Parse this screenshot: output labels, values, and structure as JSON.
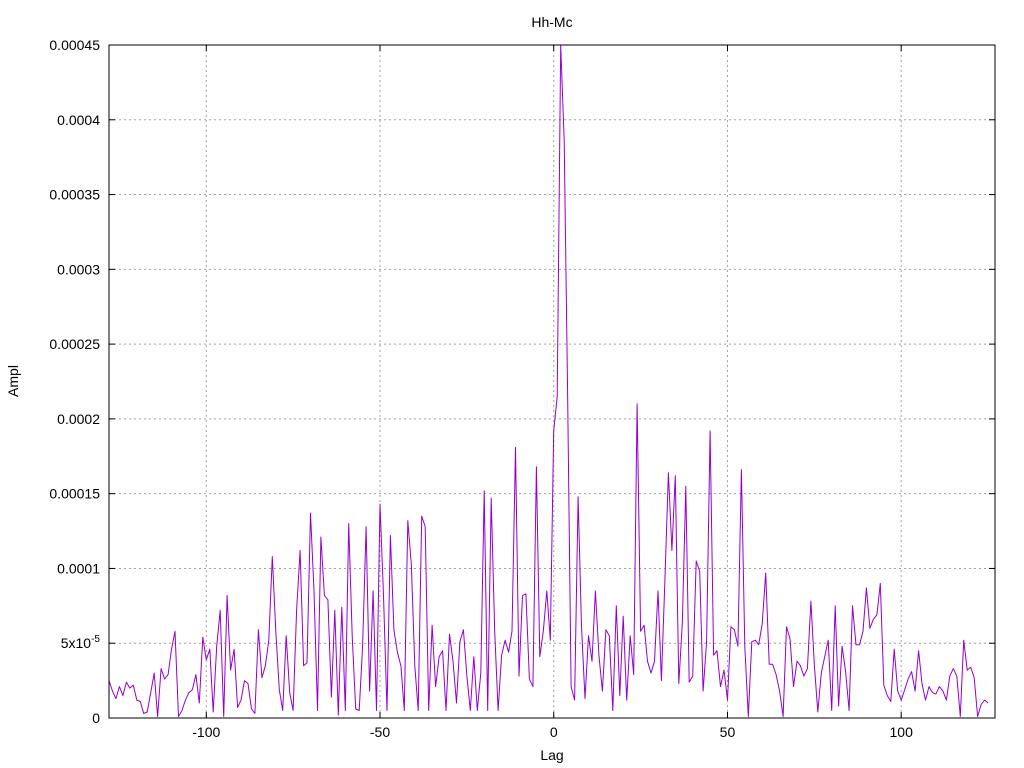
{
  "chart_data": {
    "type": "line",
    "title": "Hh-Mc",
    "xlabel": "Lag",
    "ylabel": "Ampl",
    "xlim": [
      -128,
      127
    ],
    "ylim": [
      0,
      0.00045
    ],
    "x_ticks": [
      {
        "value": -100,
        "label": "-100"
      },
      {
        "value": -50,
        "label": "-50"
      },
      {
        "value": 0,
        "label": "0"
      },
      {
        "value": 50,
        "label": "50"
      },
      {
        "value": 100,
        "label": "100"
      }
    ],
    "y_ticks": [
      {
        "value": 0,
        "label": "0"
      },
      {
        "value": 5e-05,
        "label": "5x10",
        "sup": "-5"
      },
      {
        "value": 0.0001,
        "label": "0.0001"
      },
      {
        "value": 0.00015,
        "label": "0.00015"
      },
      {
        "value": 0.0002,
        "label": "0.0002"
      },
      {
        "value": 0.00025,
        "label": "0.00025"
      },
      {
        "value": 0.0003,
        "label": "0.0003"
      },
      {
        "value": 0.00035,
        "label": "0.00035"
      },
      {
        "value": 0.0004,
        "label": "0.0004"
      },
      {
        "value": 0.00045,
        "label": "0.00045"
      }
    ],
    "grid": true,
    "series": [
      {
        "color": "#9400d3",
        "x_start": -128,
        "x_step": 1,
        "values": [
          2.5e-05,
          1.8e-05,
          1.3e-05,
          2.1e-05,
          1.5e-05,
          2.4e-05,
          2e-05,
          2.2e-05,
          1.2e-05,
          1.1e-05,
          3e-06,
          4e-06,
          1.7e-05,
          3e-05,
          1e-06,
          3.3e-05,
          2.6e-05,
          2.9e-05,
          4.6e-05,
          5.8e-05,
          1e-06,
          5e-06,
          1.2e-05,
          1.7e-05,
          1.9e-05,
          2.9e-05,
          1e-05,
          5.4e-05,
          3.9e-05,
          4.6e-05,
          4e-06,
          4.8e-05,
          7.2e-05,
          1e-06,
          8.2e-05,
          3.2e-05,
          4.6e-05,
          7e-06,
          1.2e-05,
          2.5e-05,
          2.3e-05,
          6e-06,
          3e-06,
          5.9e-05,
          2.7e-05,
          3.5e-05,
          5.2e-05,
          0.000108,
          5.8e-05,
          1.9e-05,
          5e-06,
          5.5e-05,
          1.7e-05,
          5e-06,
          7.2e-05,
          0.000112,
          3.5e-05,
          3.7e-05,
          0.000137,
          8.5e-05,
          5e-06,
          0.000121,
          8.2e-05,
          7.9e-05,
          1.4e-05,
          7.2e-05,
          2e-06,
          7.4e-05,
          5e-06,
          0.00013,
          5.5e-05,
          6e-06,
          5e-06,
          4.8e-05,
          0.000128,
          1.8e-05,
          8.5e-05,
          5e-06,
          0.000143,
          8.2e-05,
          5e-06,
          0.000122,
          5.9e-05,
          4.4e-05,
          3.5e-05,
          5e-06,
          0.000132,
          0.000103,
          3.5e-05,
          5e-06,
          0.000135,
          0.000128,
          5e-06,
          6.2e-05,
          2.1e-05,
          4.1e-05,
          4.5e-05,
          5e-06,
          5.6e-05,
          3.8e-05,
          1e-05,
          5.1e-05,
          5.9e-05,
          2.8e-05,
          5e-06,
          4.1e-05,
          5e-06,
          3e-05,
          0.000152,
          5e-06,
          0.000147,
          5.8e-05,
          5e-06,
          4.2e-05,
          5.2e-05,
          4.4e-05,
          5.8e-05,
          0.000181,
          2.8e-05,
          8.2e-05,
          8.3e-05,
          2.6e-05,
          2.1e-05,
          0.000168,
          4.1e-05,
          5.8e-05,
          8.5e-05,
          5.2e-05,
          0.000192,
          0.000215,
          0.00045,
          0.000386,
          0.000218,
          2.1e-05,
          1.2e-05,
          0.000148,
          6.1e-05,
          1.3e-05,
          5.5e-05,
          3.8e-05,
          8.5e-05,
          4.2e-05,
          1.8e-05,
          5.9e-05,
          5.5e-05,
          5e-06,
          7.5e-05,
          1.5e-05,
          6.8e-05,
          1.2e-05,
          5.5e-05,
          2.9e-05,
          0.00021,
          5.8e-05,
          6.2e-05,
          3.8e-05,
          3e-05,
          3.8e-05,
          8.5e-05,
          2.5e-05,
          9.2e-05,
          0.000164,
          0.000112,
          0.000162,
          2.3e-05,
          6.3e-05,
          0.000155,
          2.4e-05,
          2.8e-05,
          0.000105,
          9.8e-05,
          1.8e-05,
          5.1e-05,
          0.000192,
          4.2e-05,
          4.5e-05,
          2.1e-05,
          3.2e-05,
          1.2e-05,
          6.1e-05,
          5.9e-05,
          4.8e-05,
          0.000166,
          4.8e-05,
          1e-06,
          5.1e-05,
          5.2e-05,
          4.9e-05,
          6.3e-05,
          9.7e-05,
          3.6e-05,
          3.6e-05,
          2.9e-05,
          1.8e-05,
          1e-06,
          6.1e-05,
          5.3e-05,
          2.1e-05,
          3.8e-05,
          3.5e-05,
          2.8e-05,
          3.3e-05,
          7.8e-05,
          3.6e-05,
          4e-06,
          3e-05,
          4.1e-05,
          5.2e-05,
          5e-06,
          7.5e-05,
          8e-06,
          4.8e-05,
          3.1e-05,
          5e-06,
          7.5e-05,
          4.9e-05,
          4.9e-05,
          5.8e-05,
          8.7e-05,
          6e-05,
          6.6e-05,
          6.9e-05,
          9e-05,
          2.2e-05,
          1.5e-05,
          1.1e-05,
          4.6e-05,
          1.8e-05,
          1.2e-05,
          1.9e-05,
          2.6e-05,
          3.1e-05,
          1.8e-05,
          4.5e-05,
          2.3e-05,
          1.2e-05,
          2.1e-05,
          1.7e-05,
          1.6e-05,
          2.1e-05,
          1.8e-05,
          1.2e-05,
          2.8e-05,
          3.3e-05,
          2.8e-05,
          1e-06,
          5.2e-05,
          3.2e-05,
          3.4e-05,
          2.7e-05,
          1e-06,
          9e-06,
          1.2e-05,
          1e-05
        ]
      }
    ]
  }
}
